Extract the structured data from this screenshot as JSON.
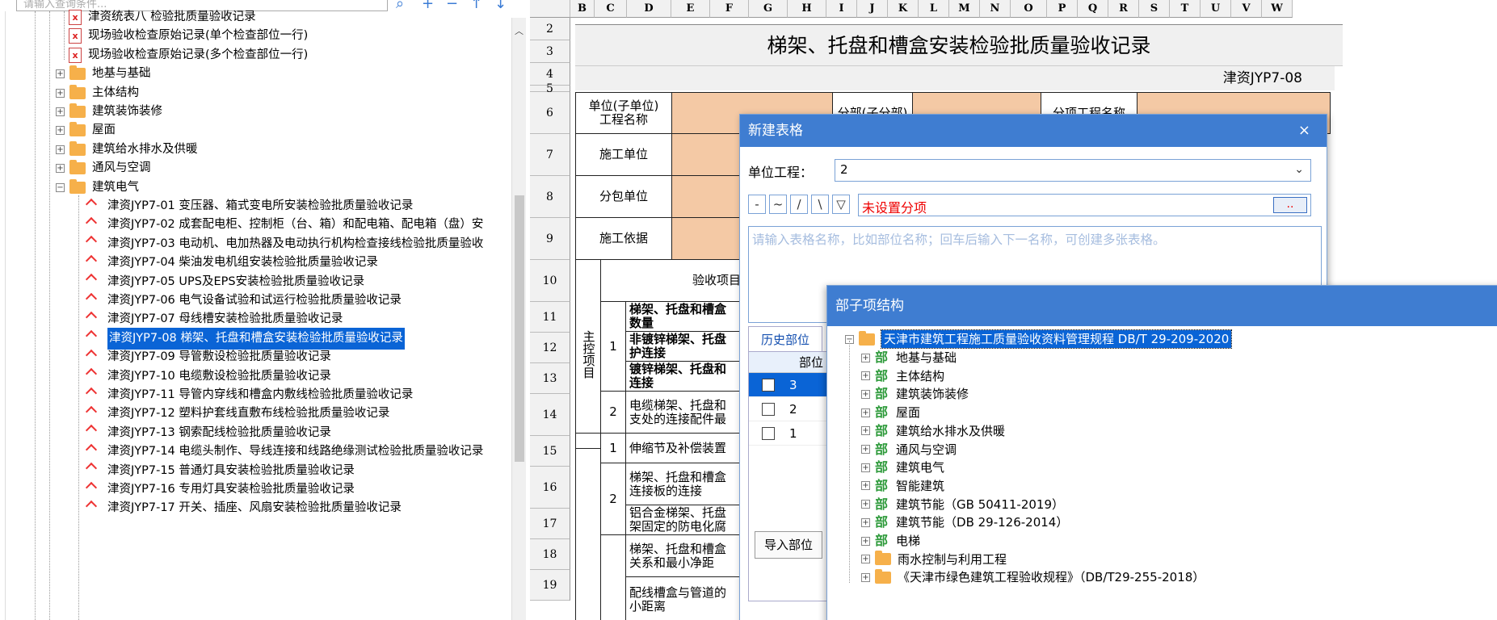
{
  "tree": {
    "search_placeholder": "请输入查询条件...",
    "items": [
      {
        "type": "doc",
        "label": "津资统表八 检验批质量验收记录"
      },
      {
        "type": "doc",
        "label": "现场验收检查原始记录(单个检查部位一行)"
      },
      {
        "type": "doc",
        "label": "现场验收检查原始记录(多个检查部位一行)"
      },
      {
        "type": "folder",
        "label": "地基与基础"
      },
      {
        "type": "folder",
        "label": "主体结构"
      },
      {
        "type": "folder",
        "label": "建筑装饰装修"
      },
      {
        "type": "folder",
        "label": "屋面"
      },
      {
        "type": "folder",
        "label": "建筑给水排水及供暖"
      },
      {
        "type": "folder",
        "label": "通风与空调"
      },
      {
        "type": "folder-open",
        "label": "建筑电气"
      },
      {
        "type": "jian",
        "label": "津资JYP7-01 变压器、箱式变电所安装检验批质量验收记录"
      },
      {
        "type": "jian",
        "label": "津资JYP7-02 成套配电柜、控制柜（台、箱）和配电箱、配电箱（盘）安"
      },
      {
        "type": "jian",
        "label": "津资JYP7-03 电动机、电加热器及电动执行机构检查接线检验批质量验收"
      },
      {
        "type": "jian",
        "label": "津资JYP7-04 柴油发电机组安装检验批质量验收记录"
      },
      {
        "type": "jian",
        "label": "津资JYP7-05 UPS及EPS安装检验批质量验收记录"
      },
      {
        "type": "jian",
        "label": "津资JYP7-06 电气设备试验和试运行检验批质量验收记录"
      },
      {
        "type": "jian",
        "label": "津资JYP7-07 母线槽安装检验批质量验收记录"
      },
      {
        "type": "jian",
        "label": "津资JYP7-08 梯架、托盘和槽盒安装检验批质量验收记录",
        "selected": true
      },
      {
        "type": "jian",
        "label": "津资JYP7-09 导管敷设检验批质量验收记录"
      },
      {
        "type": "jian",
        "label": "津资JYP7-10 电缆敷设检验批质量验收记录"
      },
      {
        "type": "jian",
        "label": "津资JYP7-11 导管内穿线和槽盒内敷线检验批质量验收记录"
      },
      {
        "type": "jian",
        "label": "津资JYP7-12 塑料护套线直敷布线检验批质量验收记录"
      },
      {
        "type": "jian",
        "label": "津资JYP7-13 钢索配线检验批质量验收记录"
      },
      {
        "type": "jian",
        "label": "津资JYP7-14 电缆头制作、导线连接和线路绝缘测试检验批质量验收记录"
      },
      {
        "type": "jian",
        "label": "津资JYP7-15 普通灯具安装检验批质量验收记录"
      },
      {
        "type": "jian",
        "label": "津资JYP7-16 专用灯具安装检验批质量验收记录"
      },
      {
        "type": "jian",
        "label": "津资JYP7-17 开关、插座、风扇安装检验批质量验收记录"
      }
    ]
  },
  "sheet": {
    "columns": [
      "B",
      "C",
      "D",
      "E",
      "F",
      "G",
      "H",
      "I",
      "J",
      "K",
      "L",
      "M",
      "N",
      "O",
      "P",
      "Q",
      "R",
      "S",
      "T",
      "U",
      "V",
      "W"
    ],
    "rows": [
      "2",
      "3",
      "4",
      "5",
      "6",
      "7",
      "8",
      "9",
      "10",
      "11",
      "12",
      "13",
      "14",
      "15",
      "16",
      "17",
      "18",
      "19"
    ],
    "title": "梯架、托盘和槽盒安装检验批质量验收记录",
    "code": "津资JYP7-08",
    "cells": {
      "unit_name": "单位(子单位)\n工程名称",
      "part_name": "分部(子分部)",
      "sub_item_name": "分项工程名称",
      "construct_unit": "施工单位",
      "subcontract_unit": "分包单位",
      "basis": "施工依据",
      "acceptance_item": "验收项目",
      "main_control": "主控项目",
      "r11_text": "梯架、托盘和槽盒\n数量",
      "r12_text": "非镀锌梯架、托盘\n护连接",
      "r13_text": "镀锌梯架、托盘和\n连接",
      "r14_text": "电缆梯架、托盘和\n支处的连接配件最",
      "r15_text": "伸缩节及补偿装置",
      "r16_text": "梯架、托盘和槽盒\n连接板的连接",
      "r17_text": "铝合金梯架、托盘\n架固定的防电化腐",
      "r18_text": "梯架、托盘和槽盒\n关系和最小净距",
      "r19_text": "配线槽盒与管道的\n小距离",
      "n1": "1",
      "n2": "2",
      "n15": "1",
      "n16": "2"
    }
  },
  "dialog_new": {
    "title": "新建表格",
    "close_label": "×",
    "unit_label": "单位工程：",
    "unit_value": "2",
    "tools": [
      "-",
      "~",
      "/",
      "\\",
      "▽"
    ],
    "subitem_value": "未设置分项",
    "subitem_btn": "..",
    "name_placeholder": "请输入表格名称，比如部位名称；回车后输入下一名称，可创建多张表格。",
    "history_tab": "历史部位",
    "history_header": "部位",
    "history_rows": [
      "3",
      "2",
      "1"
    ],
    "import_label": "导入部位"
  },
  "dialog_struct": {
    "title": "部子项结构",
    "root": "天津市建筑工程施工质量验收资料管理规程 DB/T 29-209-2020",
    "bu_label": "部",
    "items": [
      {
        "type": "bu",
        "label": "地基与基础"
      },
      {
        "type": "bu",
        "label": "主体结构"
      },
      {
        "type": "bu",
        "label": "建筑装饰装修"
      },
      {
        "type": "bu",
        "label": "屋面"
      },
      {
        "type": "bu",
        "label": "建筑给水排水及供暖"
      },
      {
        "type": "bu",
        "label": "通风与空调"
      },
      {
        "type": "bu",
        "label": "建筑电气"
      },
      {
        "type": "bu",
        "label": "智能建筑"
      },
      {
        "type": "bu",
        "label": "建筑节能（GB 50411-2019）"
      },
      {
        "type": "bu",
        "label": "建筑节能（DB 29-126-2014）"
      },
      {
        "type": "bu",
        "label": "电梯"
      },
      {
        "type": "folder",
        "label": "雨水控制与利用工程"
      },
      {
        "type": "folder",
        "label": "《天津市绿色建筑工程验收规程》（DB/T29-255-2018）"
      }
    ]
  },
  "colors": {
    "accent": "#3f7dd1",
    "selection": "#0a64d6",
    "peach": "#f4c9a5",
    "warning_text": "#e00000",
    "bu_green": "#2d9a3a"
  }
}
